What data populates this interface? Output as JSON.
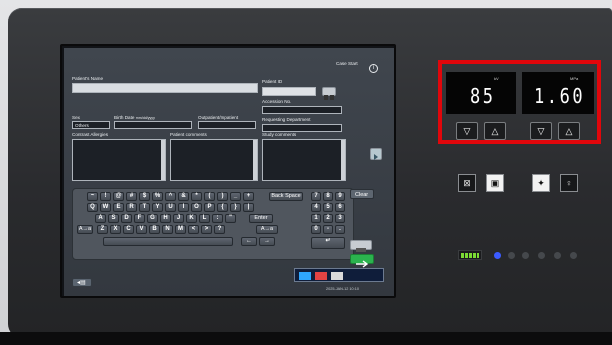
{
  "form": {
    "patient_name_label": "Patient's Name",
    "patient_id_label": "Patient ID",
    "accession_label": "Accession No.",
    "requesting_dept_label": "Requesting Department",
    "sex_label": "Sex",
    "sex_value": "Others",
    "birth_date_label": "Birth Date",
    "birth_date_format": "mm/dd/yyyy",
    "outpatient_label": "Outpatient/Inpatient",
    "allergies_label": "Contrast Allergies",
    "patient_comments_label": "Patient comments",
    "study_comments_label": "Study comments",
    "case_start_label": "Case Start",
    "clear_label": "Clear",
    "date_time": "2025-JAN-12 10:10"
  },
  "keyboard": {
    "row1": [
      "~",
      "!",
      "@",
      "#",
      "$",
      "%",
      "^",
      "&",
      "*",
      "(",
      ")",
      "_",
      "+"
    ],
    "row1_extra": "Back Space",
    "row2": [
      "Q",
      "W",
      "E",
      "R",
      "T",
      "Y",
      "U",
      "I",
      "O",
      "P",
      "{",
      "}",
      "|"
    ],
    "row3": [
      "A",
      "S",
      "D",
      "F",
      "G",
      "H",
      "J",
      "K",
      "L",
      ":",
      "\""
    ],
    "enter_label": "Enter",
    "row4": [
      "Z",
      "X",
      "C",
      "V",
      "B",
      "N",
      "M",
      "<",
      ">",
      "?"
    ],
    "shift_label": "A→a",
    "numpad": [
      "7",
      "8",
      "9",
      "4",
      "5",
      "6",
      "1",
      "2",
      "3",
      "0",
      "-",
      "."
    ]
  },
  "controls": {
    "left_display_value": "85",
    "left_display_unit": "kV",
    "right_display_value": "1.60",
    "right_display_unit": "MPa",
    "colors": {
      "highlight": "#e1060b",
      "battery": "#7cdc35",
      "indicator": "#3b5bff"
    }
  },
  "icons": {
    "info": "info-icon",
    "patient_lookup": "id-card-icon",
    "side_nav": "arrow-right-icon",
    "back": "back-icon",
    "confirm": "check-arrow-icon",
    "arm": "arm-icon",
    "patient_stand": "person-icon",
    "patient_arms": "person-arms-icon",
    "patient_off": "person-outline-icon",
    "battery": "battery-icon",
    "power": "power-icon"
  }
}
